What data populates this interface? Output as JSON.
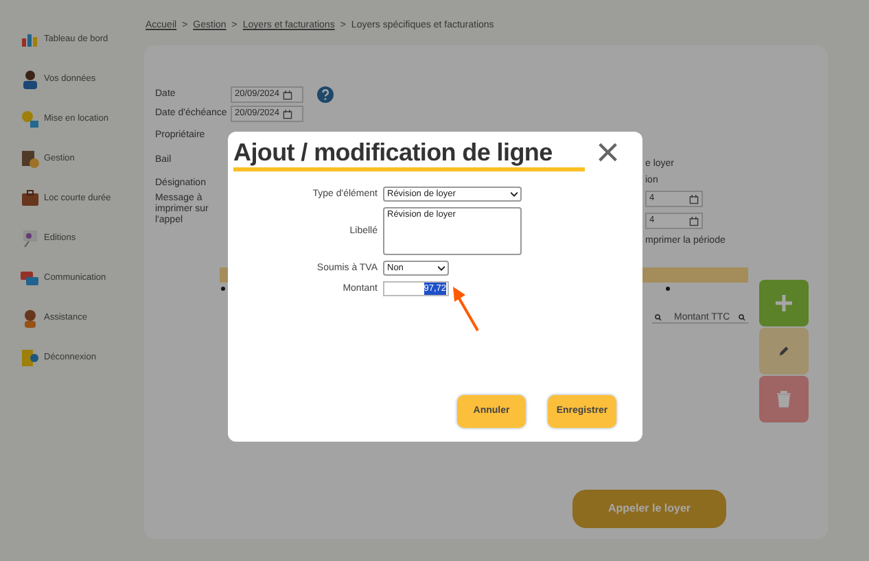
{
  "sidebar": {
    "items": [
      {
        "label": "Tableau de bord"
      },
      {
        "label": "Vos données"
      },
      {
        "label": "Mise en location"
      },
      {
        "label": "Gestion"
      },
      {
        "label": "Loc courte durée"
      },
      {
        "label": "Editions"
      },
      {
        "label": "Communication"
      },
      {
        "label": "Assistance"
      },
      {
        "label": "Déconnexion"
      }
    ]
  },
  "breadcrumb": [
    {
      "kind": "link",
      "label": "Accueil"
    },
    {
      "kind": "separator",
      "label": ">"
    },
    {
      "kind": "link",
      "label": "Gestion"
    },
    {
      "kind": "separator",
      "label": ">"
    },
    {
      "kind": "link",
      "label": "Loyers et facturations"
    },
    {
      "kind": "separator",
      "label": ">"
    },
    {
      "kind": "current",
      "label": "Loyers spécifiques et facturations"
    }
  ],
  "form": {
    "date": {
      "label": "Date",
      "value": "20/09/2024"
    },
    "due_date": {
      "label": "Date d'échéance",
      "value": "20/09/2024"
    },
    "labels": [
      "Propriétaire",
      "Bail",
      "Désignation",
      "Message à imprimer sur l'appel"
    ]
  },
  "right_fragments": {
    "texts": [
      "e loyer",
      "ion"
    ],
    "dates": [
      "4",
      "4"
    ],
    "checkbox_label": "mprimer la période"
  },
  "table": {
    "column_header": "Montant TTC"
  },
  "submit_button": "Appeler le loyer",
  "modal": {
    "title": "Ajout / modification de ligne",
    "close": "×",
    "fields": [
      {
        "kind": "select",
        "label": "Type d'élément",
        "value": "Révision de loyer"
      },
      {
        "kind": "textarea",
        "label": "Libellé",
        "value": "Révision de loyer"
      },
      {
        "kind": "select",
        "label": "Soumis à TVA",
        "value": "Non"
      },
      {
        "kind": "input",
        "label": "Montant",
        "value": "97,72",
        "selected": true
      }
    ],
    "buttons": [
      "Annuler",
      "Enregistrer"
    ]
  }
}
